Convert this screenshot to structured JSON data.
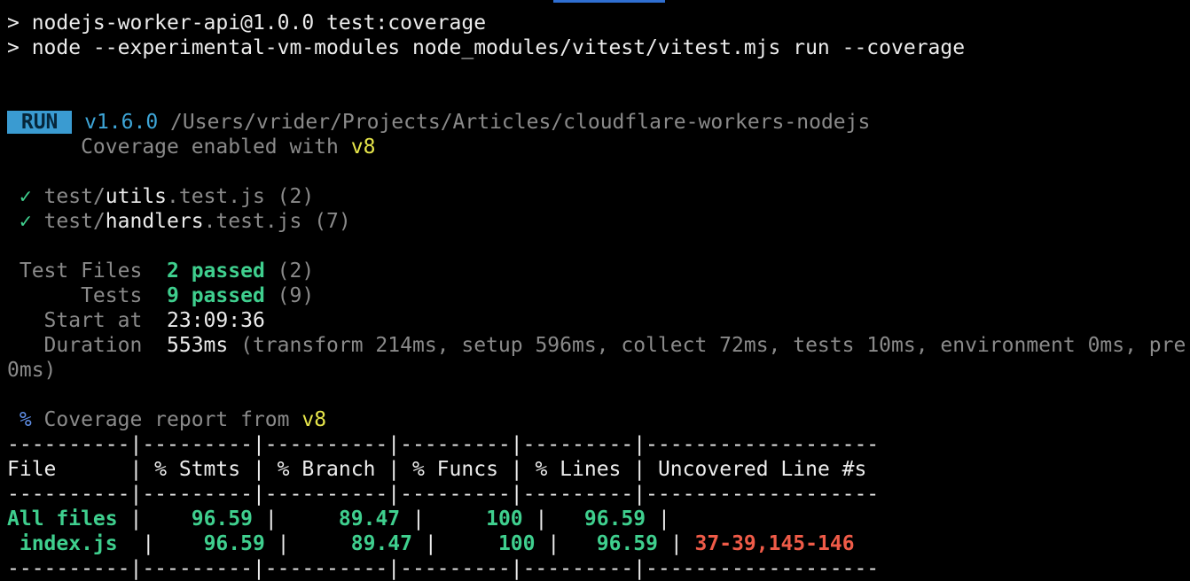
{
  "npm_header": {
    "script_line": "> nodejs-worker-api@1.0.0 test:coverage",
    "command_line": "> node --experimental-vm-modules node_modules/vitest/vitest.mjs run --coverage"
  },
  "run": {
    "badge": " RUN ",
    "version": "v1.6.0",
    "path": " /Users/vrider/Projects/Articles/cloudflare-workers-nodejs",
    "coverage_prefix": "      Coverage enabled with ",
    "coverage_provider": "v8"
  },
  "test_results": [
    {
      "check": " ✓",
      "dir": " test/",
      "name": "utils",
      "ext": ".test.js",
      "count": " (2)"
    },
    {
      "check": " ✓",
      "dir": " test/",
      "name": "handlers",
      "ext": ".test.js",
      "count": " (7)"
    }
  ],
  "summary": {
    "test_files": {
      "label": " Test Files  ",
      "value": "2 passed",
      "extra": " (2)"
    },
    "tests": {
      "label": "      Tests  ",
      "value": "9 passed",
      "extra": " (9)"
    },
    "start_at": {
      "label": "   Start at  ",
      "value": "23:09:36"
    },
    "duration": {
      "label": "   Duration  ",
      "value": "553ms",
      "detail": " (transform 214ms, setup 596ms, collect 72ms, tests 10ms, environment 0ms, pre",
      "wrap": "0ms)"
    }
  },
  "coverage_report": {
    "symbol": " %",
    "title": " Coverage report from ",
    "provider": "v8",
    "separator": "----------|---------|----------|---------|---------|-------------------",
    "headers": [
      "File",
      "% Stmts",
      "% Branch",
      "% Funcs",
      "% Lines",
      "Uncovered Line #s"
    ],
    "rows": [
      {
        "file": "All files",
        "stmts": "96.59",
        "branch": "89.47",
        "funcs": "100",
        "lines": "96.59",
        "uncovered": ""
      },
      {
        "file": " index.js",
        "stmts": "96.59",
        "branch": "89.47",
        "funcs": "100",
        "lines": "96.59",
        "uncovered": "37-39,145-146"
      }
    ]
  },
  "colors": {
    "background": "#000000",
    "pass_green": "#3fcf8e",
    "run_badge": "#3a9bd1",
    "provider_yellow": "#e6e54a",
    "uncovered_red": "#ef5b48"
  }
}
